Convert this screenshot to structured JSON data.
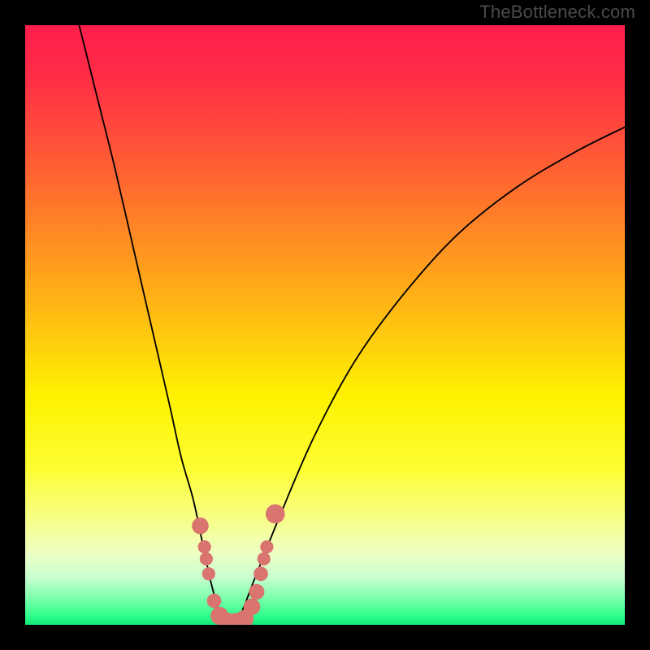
{
  "attribution": "TheBottleneck.com",
  "colors": {
    "frame": "#000000",
    "gradient_stops": [
      {
        "offset": 0.0,
        "color": "#ff1e4c"
      },
      {
        "offset": 0.08,
        "color": "#ff2b47"
      },
      {
        "offset": 0.2,
        "color": "#ff5238"
      },
      {
        "offset": 0.35,
        "color": "#ff8a23"
      },
      {
        "offset": 0.5,
        "color": "#ffc310"
      },
      {
        "offset": 0.62,
        "color": "#fff200"
      },
      {
        "offset": 0.74,
        "color": "#fdfd33"
      },
      {
        "offset": 0.83,
        "color": "#f6ff8e"
      },
      {
        "offset": 0.88,
        "color": "#eeffc4"
      },
      {
        "offset": 0.92,
        "color": "#c9ffd0"
      },
      {
        "offset": 0.955,
        "color": "#7dffad"
      },
      {
        "offset": 0.985,
        "color": "#2eff8a"
      },
      {
        "offset": 1.0,
        "color": "#13e877"
      }
    ],
    "curve": "#000000",
    "marker": "#d9746e"
  },
  "chart_data": {
    "type": "line",
    "title": "",
    "xlabel": "",
    "ylabel": "",
    "xlim": [
      0,
      100
    ],
    "ylim": [
      0,
      100
    ],
    "grid": false,
    "legend": false,
    "series": [
      {
        "name": "bottleneck-curve",
        "x": [
          9,
          12,
          15,
          18,
          21,
          24,
          26,
          28,
          29.5,
          31,
          32.5,
          34,
          36,
          38,
          42,
          48,
          55,
          63,
          72,
          82,
          92,
          100
        ],
        "y": [
          100,
          88,
          76,
          63,
          50,
          37,
          28,
          21,
          14,
          7,
          2,
          0,
          2,
          7,
          17,
          31,
          44,
          55,
          65,
          73,
          79,
          83
        ]
      }
    ],
    "markers": [
      {
        "x": 29.2,
        "y": 16.5,
        "r": 1.4
      },
      {
        "x": 29.9,
        "y": 13.0,
        "r": 1.1
      },
      {
        "x": 30.2,
        "y": 11.0,
        "r": 1.1
      },
      {
        "x": 30.6,
        "y": 8.5,
        "r": 1.1
      },
      {
        "x": 31.5,
        "y": 4.0,
        "r": 1.2
      },
      {
        "x": 32.4,
        "y": 1.5,
        "r": 1.5
      },
      {
        "x": 33.8,
        "y": 0.5,
        "r": 1.5
      },
      {
        "x": 35.2,
        "y": 0.5,
        "r": 1.5
      },
      {
        "x": 36.6,
        "y": 1.0,
        "r": 1.5
      },
      {
        "x": 37.8,
        "y": 3.0,
        "r": 1.4
      },
      {
        "x": 38.6,
        "y": 5.5,
        "r": 1.3
      },
      {
        "x": 39.3,
        "y": 8.5,
        "r": 1.2
      },
      {
        "x": 39.8,
        "y": 11.0,
        "r": 1.1
      },
      {
        "x": 40.3,
        "y": 13.0,
        "r": 1.1
      },
      {
        "x": 41.7,
        "y": 18.5,
        "r": 1.6
      }
    ]
  }
}
